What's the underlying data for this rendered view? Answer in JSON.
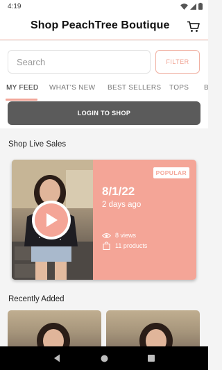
{
  "status_bar": {
    "time": "4:19"
  },
  "header": {
    "title": "Shop PeachTree Boutique",
    "cart_icon": "cart-icon"
  },
  "search": {
    "placeholder": "Search",
    "value": "",
    "filter_label": "FILTER"
  },
  "tabs": [
    {
      "label": "MY FEED",
      "active": true
    },
    {
      "label": "WHAT'S NEW",
      "active": false
    },
    {
      "label": "BEST SELLERS",
      "active": false
    },
    {
      "label": "TOPS",
      "active": false
    },
    {
      "label": "B",
      "active": false
    }
  ],
  "login": {
    "label": "LOGIN TO SHOP"
  },
  "live_sales": {
    "section_title": "Shop Live Sales",
    "card": {
      "badge": "POPULAR",
      "date": "8/1/22",
      "ago": "2 days ago",
      "views": "8 views",
      "products": "11 products"
    }
  },
  "recently_added": {
    "section_title": "Recently Added"
  },
  "colors": {
    "accent": "#f4a597",
    "login_bg": "#5b5b5b",
    "nav_bg": "#000000"
  }
}
